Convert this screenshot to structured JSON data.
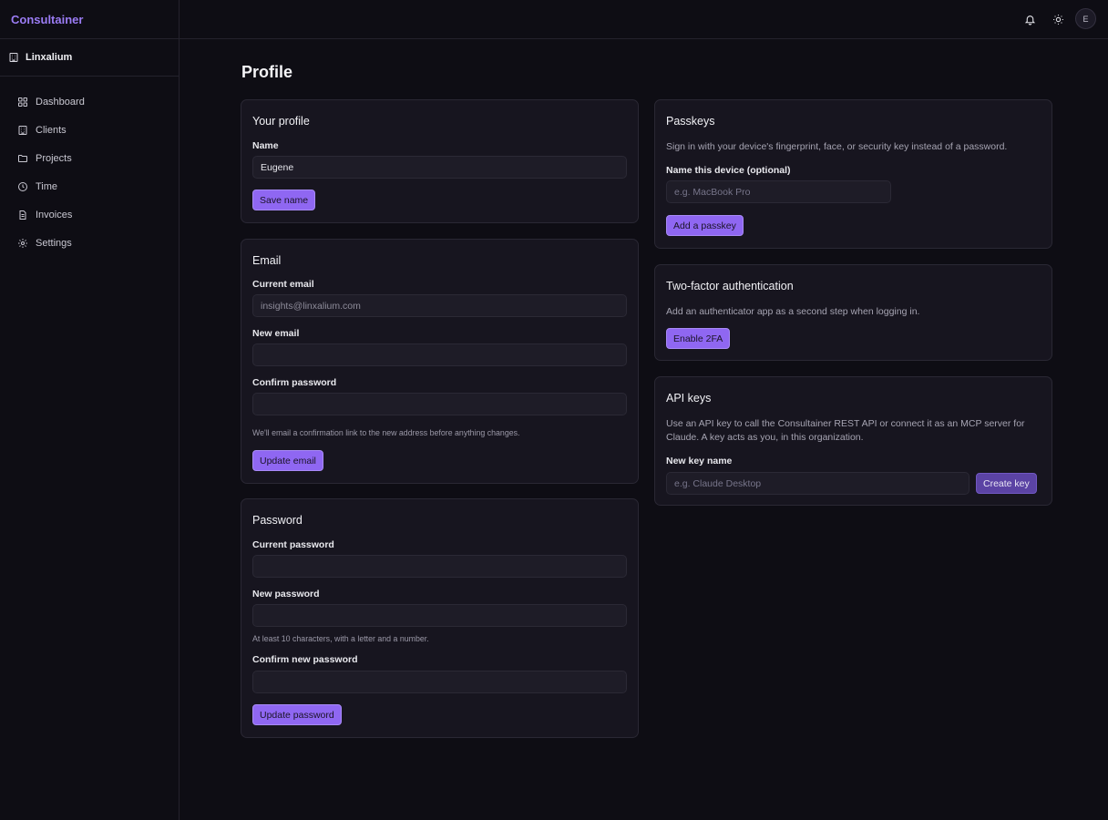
{
  "app": {
    "brand": "Consultainer",
    "org": "Linxalium"
  },
  "sidebar": {
    "items": [
      {
        "label": "Dashboard",
        "icon": "grid-icon"
      },
      {
        "label": "Clients",
        "icon": "building-icon"
      },
      {
        "label": "Projects",
        "icon": "folder-icon"
      },
      {
        "label": "Time",
        "icon": "clock-icon"
      },
      {
        "label": "Invoices",
        "icon": "document-icon"
      },
      {
        "label": "Settings",
        "icon": "gear-icon"
      }
    ]
  },
  "topbar": {
    "avatar_initial": "E"
  },
  "page": {
    "title": "Profile"
  },
  "profile": {
    "title": "Your profile",
    "name_label": "Name",
    "name_value": "Eugene",
    "save_label": "Save name"
  },
  "email": {
    "title": "Email",
    "current_label": "Current email",
    "current_value": "insights@linxalium.com",
    "new_label": "New email",
    "new_value": "",
    "confirm_label": "Confirm password",
    "hint": "We'll email a confirmation link to the new address before anything changes.",
    "button": "Update email"
  },
  "password": {
    "title": "Password",
    "current_label": "Current password",
    "new_label": "New password",
    "hint": "At least 10 characters, with a letter and a number.",
    "confirm_label": "Confirm new password",
    "button": "Update password"
  },
  "passkeys": {
    "title": "Passkeys",
    "description": "Sign in with your device's fingerprint, face, or security key instead of a password.",
    "device_label": "Name this device (optional)",
    "device_placeholder": "e.g. MacBook Pro",
    "button": "Add a passkey"
  },
  "twofa": {
    "title": "Two-factor authentication",
    "description": "Add an authenticator app as a second step when logging in.",
    "button": "Enable 2FA"
  },
  "api": {
    "title": "API keys",
    "description_line1": "Use an API key to call the Consultainer REST API or connect it as an MCP server for",
    "description_line2": "Claude. A key acts as you, in this organization.",
    "key_label": "New key name",
    "key_placeholder": "e.g. Claude Desktop",
    "button": "Create key"
  },
  "colors": {
    "accent": "#8f67f2",
    "brand": "#9b7cf4",
    "background": "#0e0d14",
    "card": "#17151f"
  }
}
